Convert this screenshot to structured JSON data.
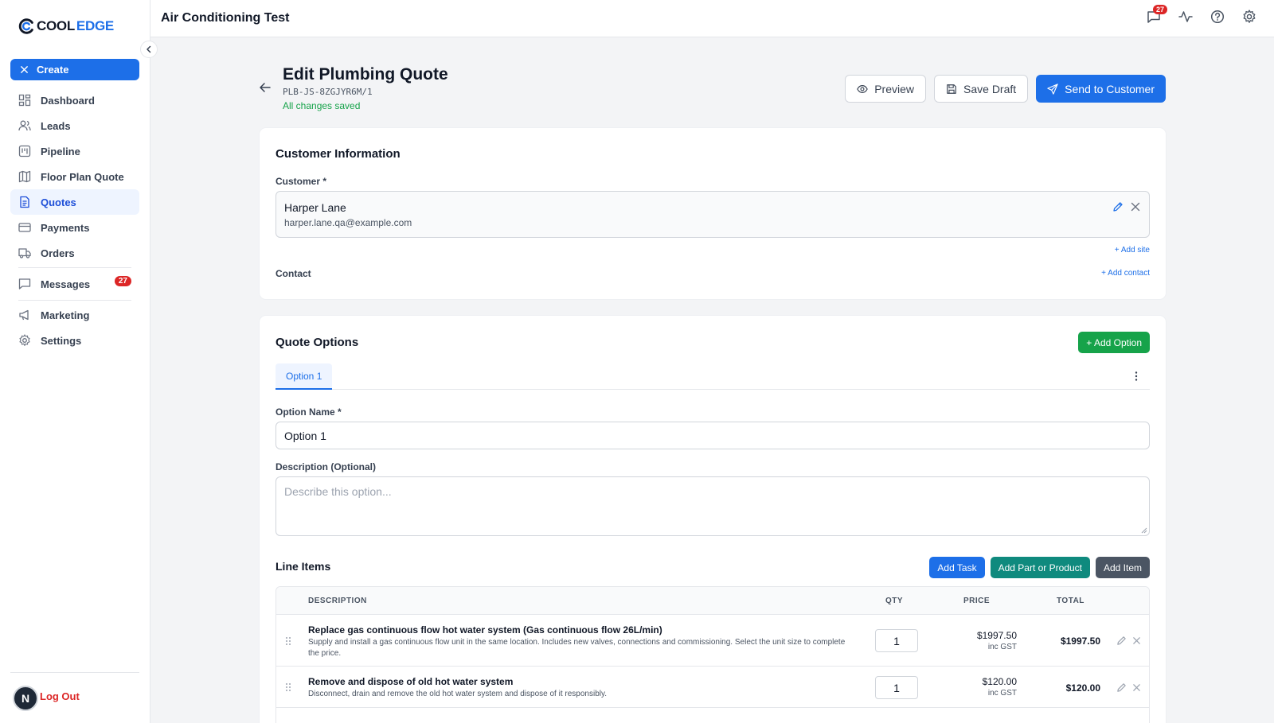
{
  "sidebar": {
    "logo": {
      "part1": "COOL",
      "part2": "EDGE"
    },
    "create_label": "Create",
    "items": [
      {
        "label": "Dashboard",
        "icon": "dashboard-icon"
      },
      {
        "label": "Leads",
        "icon": "users-icon"
      },
      {
        "label": "Pipeline",
        "icon": "pipeline-icon"
      },
      {
        "label": "Floor Plan Quote",
        "icon": "map-icon"
      },
      {
        "label": "Quotes",
        "icon": "document-icon",
        "active": true
      },
      {
        "label": "Payments",
        "icon": "credit-card-icon"
      },
      {
        "label": "Orders",
        "icon": "truck-icon"
      },
      {
        "label": "Messages",
        "icon": "chat-icon",
        "badge": "27"
      },
      {
        "label": "Marketing",
        "icon": "megaphone-icon"
      },
      {
        "label": "Settings",
        "icon": "gear-icon"
      }
    ],
    "avatar_initial": "N",
    "logout_label": "Log Out"
  },
  "topbar": {
    "title": "Air Conditioning Test",
    "notifications_badge": "27"
  },
  "header": {
    "title": "Edit Plumbing Quote",
    "quote_ref": "PLB-JS-8ZGJYR6M/1",
    "save_status": "All changes saved",
    "preview_label": "Preview",
    "save_draft_label": "Save Draft",
    "send_label": "Send to Customer"
  },
  "customer_info": {
    "title": "Customer Information",
    "customer_label": "Customer *",
    "customer_name": "Harper Lane",
    "customer_email": "harper.lane.qa@example.com",
    "add_site_label": "+ Add site",
    "contact_label": "Contact",
    "add_contact_label": "+ Add contact"
  },
  "quote_options": {
    "title": "Quote Options",
    "add_option_label": "+ Add Option",
    "tabs": [
      "Option 1"
    ],
    "option_name_label": "Option Name *",
    "option_name_value": "Option 1",
    "description_label": "Description (Optional)",
    "description_placeholder": "Describe this option..."
  },
  "line_items": {
    "title": "Line Items",
    "add_task_label": "Add Task",
    "add_part_label": "Add Part or Product",
    "add_item_label": "Add Item",
    "columns": {
      "description": "DESCRIPTION",
      "qty": "QTY",
      "price": "PRICE",
      "total": "TOTAL"
    },
    "rows": [
      {
        "title": "Replace gas continuous flow hot water system (Gas continuous flow 26L/min)",
        "description": "Supply and install a gas continuous flow unit in the same location. Includes new valves, connections and commissioning. Select the unit size to complete the price.",
        "qty": "1",
        "price": "$1997.50",
        "gst": "inc GST",
        "total": "$1997.50"
      },
      {
        "title": "Remove and dispose of old hot water system",
        "description": "Disconnect, drain and remove the old hot water system and dispose of it responsibly.",
        "qty": "1",
        "price": "$120.00",
        "gst": "inc GST",
        "total": "$120.00"
      }
    ]
  },
  "colors": {
    "accent": "#1d6fe8",
    "success": "#16a34a",
    "danger": "#dc2626",
    "teal": "#0f8a7e"
  }
}
